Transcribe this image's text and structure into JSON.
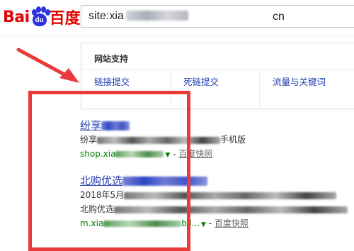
{
  "header": {
    "logo": {
      "part1": "Bai",
      "paw": "du",
      "part2": "百度"
    },
    "search": {
      "value": "site:xia",
      "value_suffix": "cn"
    }
  },
  "panel": {
    "title": "网站支持",
    "links": [
      "链接提交",
      "死链提交",
      "流量与关键词"
    ]
  },
  "results": [
    {
      "title_prefix": "纷享",
      "snippet_prefix": "纷享",
      "snippet_suffix": "手机版",
      "url_prefix": "shop.xia",
      "snapshot": "百度快照"
    },
    {
      "title_prefix": "北购优选",
      "date": "2018年5月",
      "snippet_prefix": "北购优选",
      "url_prefix": "m.xia",
      "url_suffix": "bil...",
      "snapshot": "百度快照"
    }
  ],
  "colors": {
    "link": "#2440b3",
    "url": "#008000",
    "annotation": "#ea3b3b",
    "brand_red": "#e10601",
    "brand_blue": "#2932e1"
  }
}
